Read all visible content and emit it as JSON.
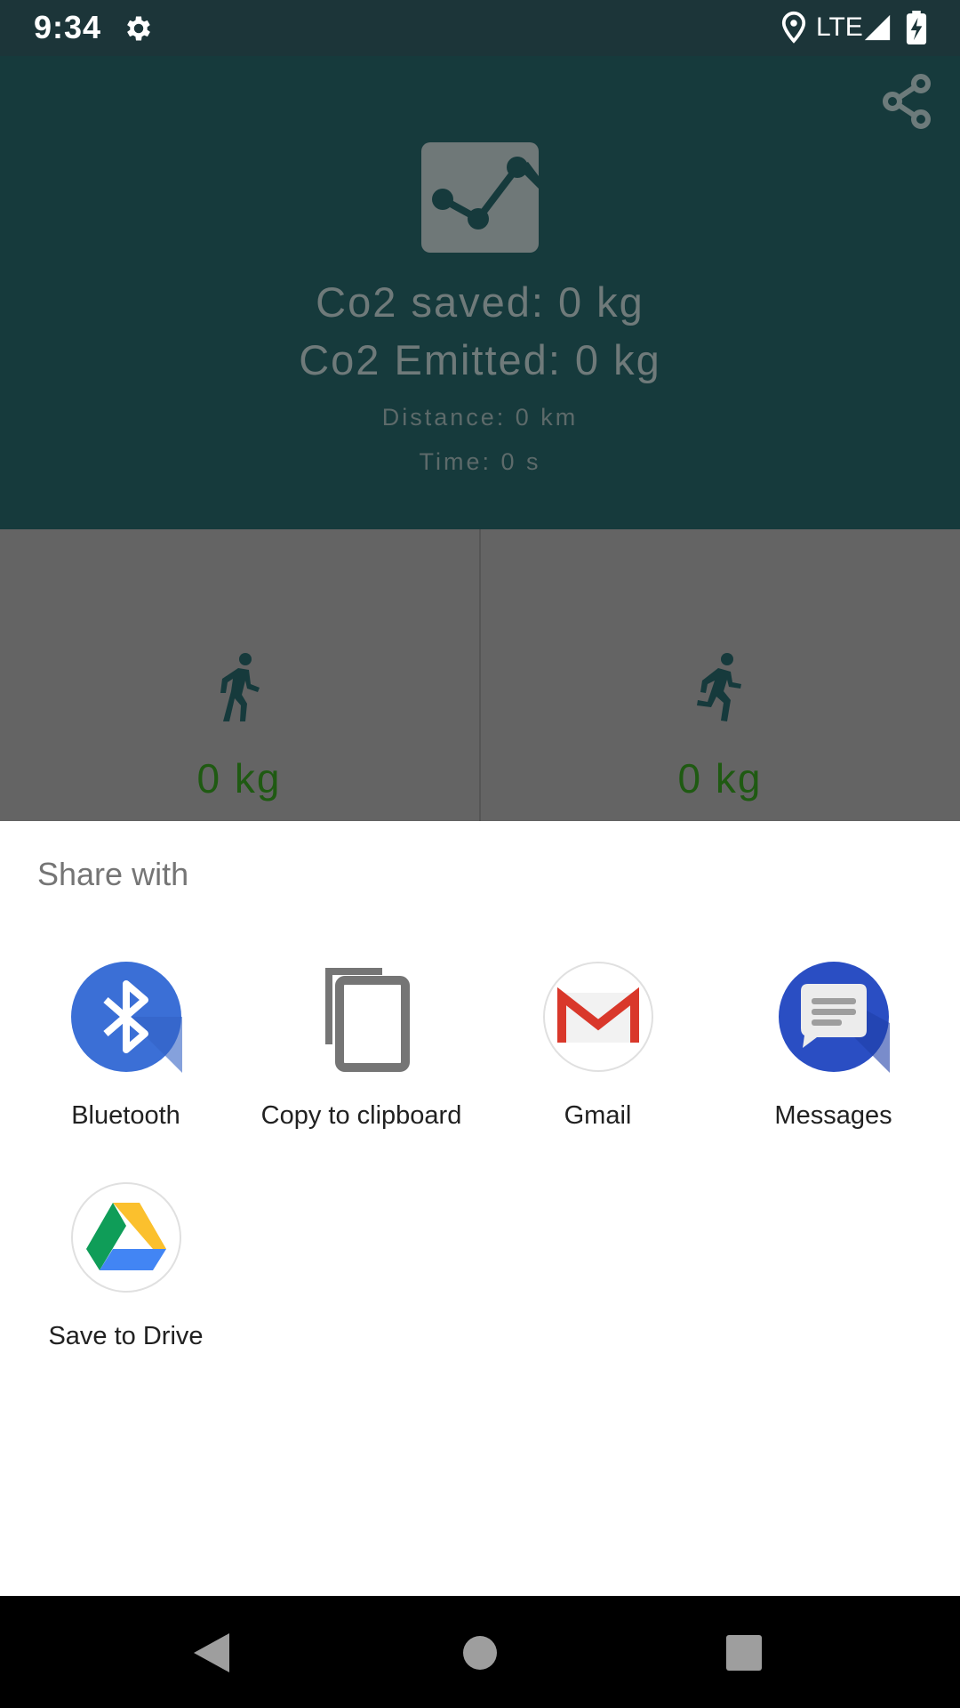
{
  "status_bar": {
    "time": "9:34",
    "network": "LTE",
    "icons": [
      "gear-icon",
      "location-icon",
      "signal-icon",
      "battery-charging-icon"
    ]
  },
  "app": {
    "co2_saved": "Co2 saved: 0 kg",
    "co2_emitted": "Co2 Emitted: 0 kg",
    "distance": "Distance: 0 km",
    "time": "Time: 0 s",
    "walk_value": "0 kg",
    "run_value": "0 kg",
    "icons": [
      "share-icon",
      "chart-icon",
      "walk-icon",
      "run-icon"
    ]
  },
  "share_sheet": {
    "title": "Share with",
    "items": [
      {
        "label": "Bluetooth",
        "icon": "bluetooth-icon"
      },
      {
        "label": "Copy to clipboard",
        "icon": "copy-icon"
      },
      {
        "label": "Gmail",
        "icon": "gmail-icon"
      },
      {
        "label": "Messages",
        "icon": "messages-icon"
      },
      {
        "label": "Save to Drive",
        "icon": "drive-icon"
      }
    ]
  },
  "nav_bar": {
    "icons": [
      "back-icon",
      "home-icon",
      "recents-icon"
    ]
  },
  "colors": {
    "status_bar": "#1c3539",
    "header_bg": "#163a3c",
    "panel_bg": "#646464",
    "kg_text": "#1f5a12",
    "bluetooth": "#3b6fd6",
    "messages": "#2a4ec3"
  }
}
